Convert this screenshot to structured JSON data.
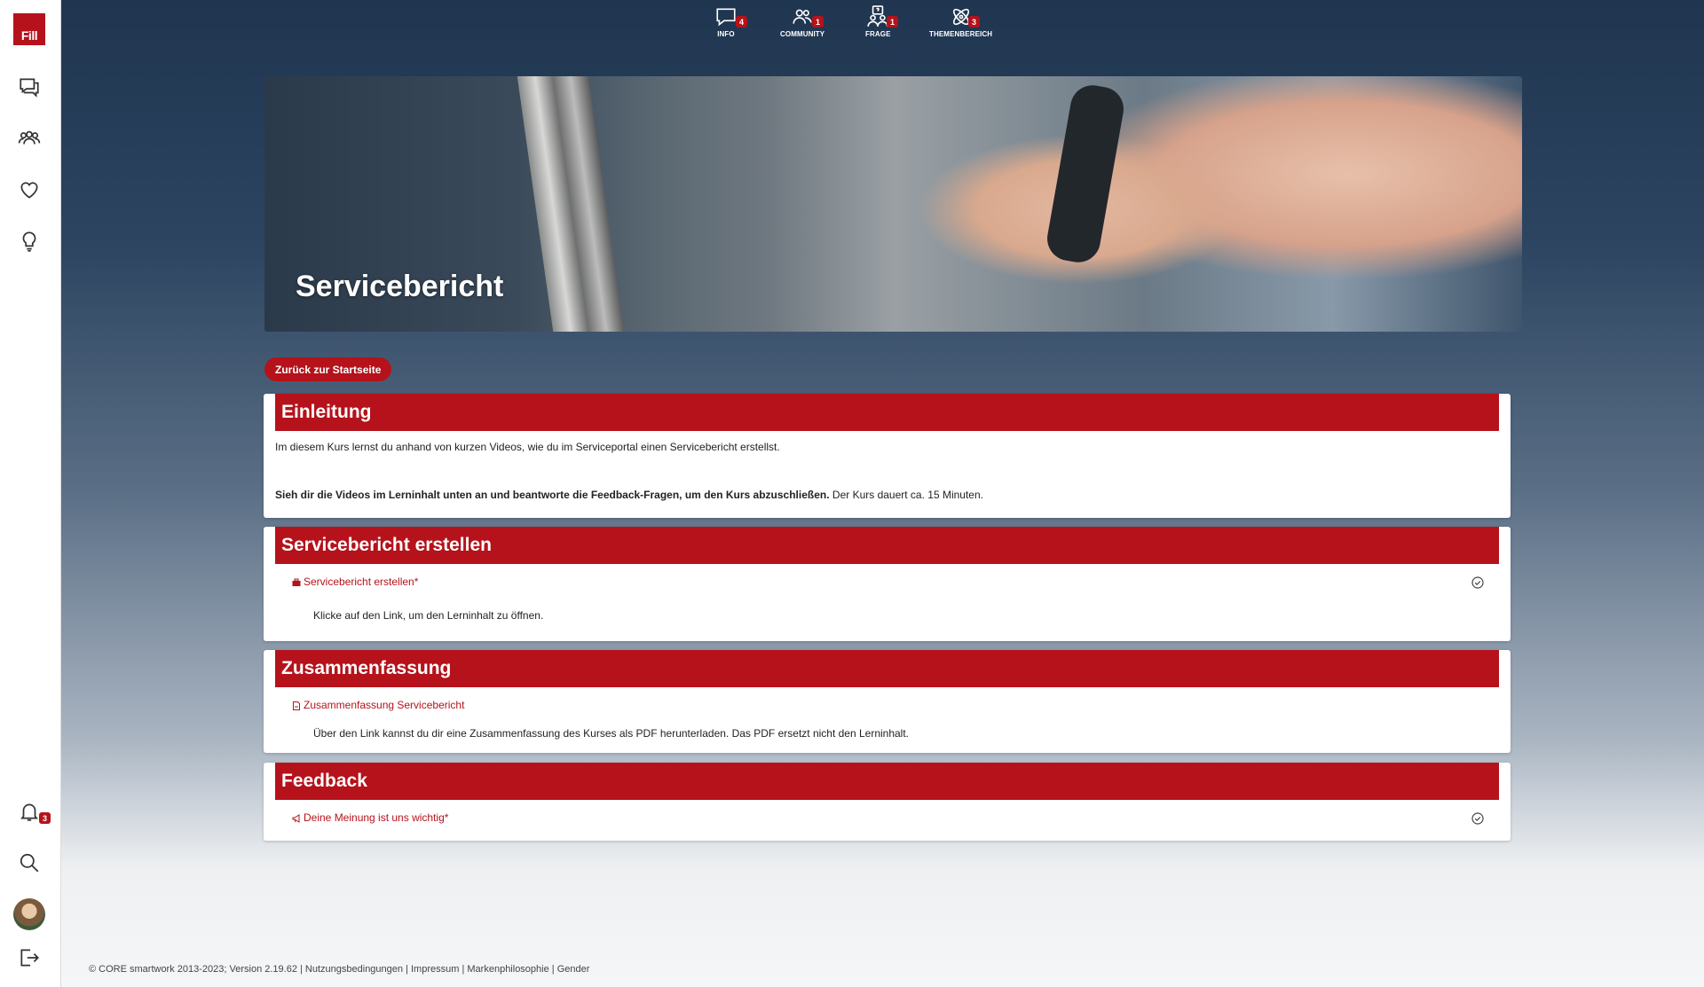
{
  "brand": {
    "logo_text": "Fill",
    "accent": "#b5121b"
  },
  "sidebar": {
    "items": [
      {
        "name": "chat-icon"
      },
      {
        "name": "community-icon"
      },
      {
        "name": "heart-icon"
      },
      {
        "name": "lightbulb-icon"
      }
    ],
    "notifications_badge": "3"
  },
  "topnav": {
    "items": [
      {
        "label": "INFO",
        "badge": "4",
        "icon": "chat-icon"
      },
      {
        "label": "COMMUNITY",
        "badge": "1",
        "icon": "community-icon"
      },
      {
        "label": "FRAGE",
        "badge": "1",
        "icon": "question-icon"
      },
      {
        "label": "THEMENBEREICH",
        "badge": "3",
        "icon": "atom-icon"
      }
    ]
  },
  "hero": {
    "title": "Servicebericht"
  },
  "back_button": "Zurück zur Startseite",
  "sections": {
    "intro": {
      "title": "Einleitung",
      "text1": "Im diesem Kurs lernst du anhand von kurzen Videos, wie du im Serviceportal einen Servicebericht erstellst.",
      "text2_bold": "Sieh dir die Videos im Lerninhalt unten an und beantworte die Feedback-Fragen, um den Kurs abzuschließen.",
      "text2_rest": " Der Kurs dauert ca. 15 Minuten."
    },
    "create": {
      "title": "Servicebericht erstellen",
      "link": "Servicebericht erstellen*",
      "desc": "Klicke auf den Link, um den Lerninhalt zu öffnen."
    },
    "summary": {
      "title": "Zusammenfassung",
      "link": "Zusammenfassung Servicebericht",
      "desc": "Über den Link kannst du dir eine Zusammenfassung des Kurses als PDF herunterladen. Das PDF ersetzt nicht den Lerninhalt."
    },
    "feedback": {
      "title": "Feedback",
      "link": "Deine Meinung ist uns wichtig*"
    }
  },
  "footer": {
    "copyright": "© CORE smartwork 2013-2023; Version 2.19.62 |",
    "links": [
      "Nutzungsbedingungen",
      "Impressum",
      "Markenphilosophie",
      "Gender"
    ]
  }
}
